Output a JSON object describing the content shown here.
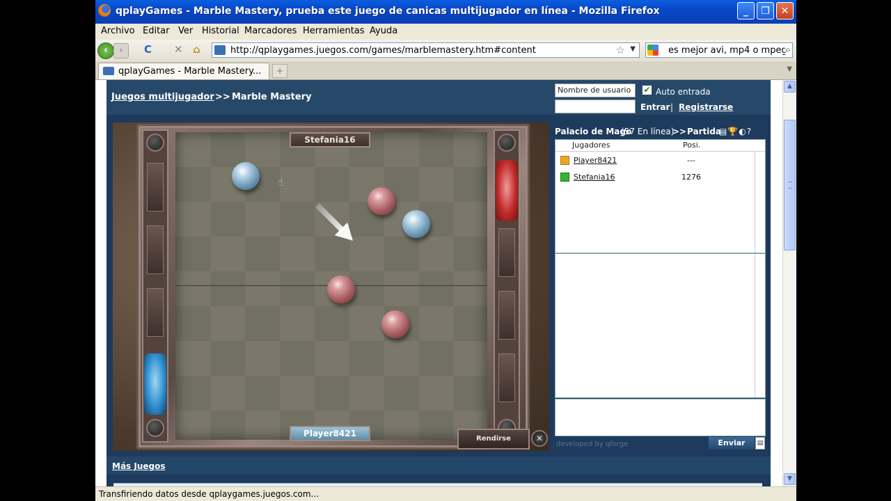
{
  "window": {
    "title": "qplayGames - Marble Mastery, prueba este juego de canicas multijugador en línea - Mozilla Firefox",
    "controls": {
      "minimize": "_",
      "maximize": "❐",
      "close": "✕"
    }
  },
  "menu": [
    "Archivo",
    "Editar",
    "Ver",
    "Historial",
    "Marcadores",
    "Herramientas",
    "Ayuda"
  ],
  "nav": {
    "back": "‹",
    "forward": "›",
    "reload": "C",
    "stop": "✕",
    "home": "⌂",
    "url": "http://qplaygames.juegos.com/games/marblemastery.htm#content",
    "bookmark_star": "☆",
    "search_value": "es mejor avi, mp4 o mpeg",
    "search_icon": "magnifier-icon"
  },
  "tab": {
    "label": "qplayGames - Marble Mastery...",
    "new_tab": "+"
  },
  "site": {
    "breadcrumb_link": "Juegos multijugador",
    "breadcrumb_sep": ">>",
    "breadcrumb_current": "Marble Mastery",
    "username_placeholder": "Nombre de usuario",
    "auto_login_label": "Auto entrada",
    "auto_login_checked": "✔",
    "login_label": "Entrar",
    "separator": "|",
    "register_label": "Registrarse",
    "more_games": "Más Juegos"
  },
  "game": {
    "top_player": "Stefania16",
    "bottom_player": "Player8421",
    "surrender_label": "Rendirse",
    "tool_icon": "✕"
  },
  "room": {
    "name": "Palacio de Mago",
    "online": "(57 En línea)",
    "sep": ">>",
    "view": "Partida",
    "icons": "▤🏆◐?",
    "col_players": "Jugadores",
    "col_position": "Posi.",
    "players": [
      {
        "name": "Player8421",
        "position": "---",
        "color": "#e8a623"
      },
      {
        "name": "Stefania16",
        "position": "1276",
        "color": "#2fb52f"
      }
    ],
    "developed_by": "developed by qforge",
    "send_label": "Enviar",
    "send_icon": "▤"
  },
  "status": "Transfiriendo datos desde qplaygames.juegos.com..."
}
